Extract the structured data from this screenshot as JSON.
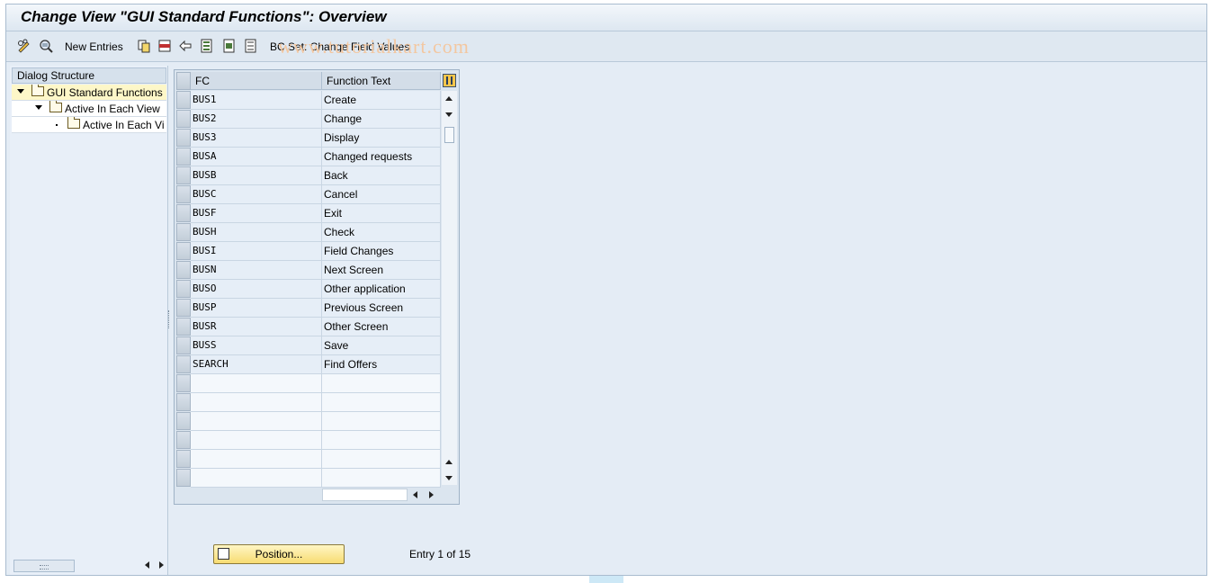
{
  "window": {
    "title": "Change View \"GUI Standard Functions\": Overview"
  },
  "toolbar": {
    "icons": [
      "edit-toggle-icon",
      "display-change-icon",
      "copy-icon",
      "delete-icon",
      "undo-icon",
      "select-all-icon",
      "select-block-icon",
      "deselect-all-icon"
    ],
    "new_entries_label": "New Entries",
    "bc_set_label": "BC Set: Change Field Values",
    "watermark": "www.tutorialkart.com"
  },
  "dialog_structure": {
    "header": "Dialog Structure",
    "items": [
      {
        "label": "GUI Standard Functions",
        "icon": "open-folder-icon",
        "selected": true
      },
      {
        "label": "Active In Each View",
        "icon": "folder-icon",
        "selected": false
      },
      {
        "label": "Active In Each Vi",
        "icon": "folder-icon",
        "selected": false
      }
    ]
  },
  "table": {
    "columns": [
      "FC",
      "Function Text"
    ],
    "rows": [
      {
        "fc": "BUS1",
        "text": "Create"
      },
      {
        "fc": "BUS2",
        "text": "Change"
      },
      {
        "fc": "BUS3",
        "text": "Display"
      },
      {
        "fc": "BUSA",
        "text": "Changed requests"
      },
      {
        "fc": "BUSB",
        "text": "Back"
      },
      {
        "fc": "BUSC",
        "text": "Cancel"
      },
      {
        "fc": "BUSF",
        "text": "Exit"
      },
      {
        "fc": "BUSH",
        "text": "Check"
      },
      {
        "fc": "BUSI",
        "text": "Field Changes"
      },
      {
        "fc": "BUSN",
        "text": "Next Screen"
      },
      {
        "fc": "BUSO",
        "text": "Other application"
      },
      {
        "fc": "BUSP",
        "text": "Previous Screen"
      },
      {
        "fc": "BUSR",
        "text": "Other Screen"
      },
      {
        "fc": "BUSS",
        "text": "Save"
      },
      {
        "fc": "SEARCH",
        "text": "Find Offers"
      }
    ],
    "empty_rows": 6
  },
  "footer": {
    "position_button": "Position...",
    "entry_info": "Entry 1 of 15"
  }
}
